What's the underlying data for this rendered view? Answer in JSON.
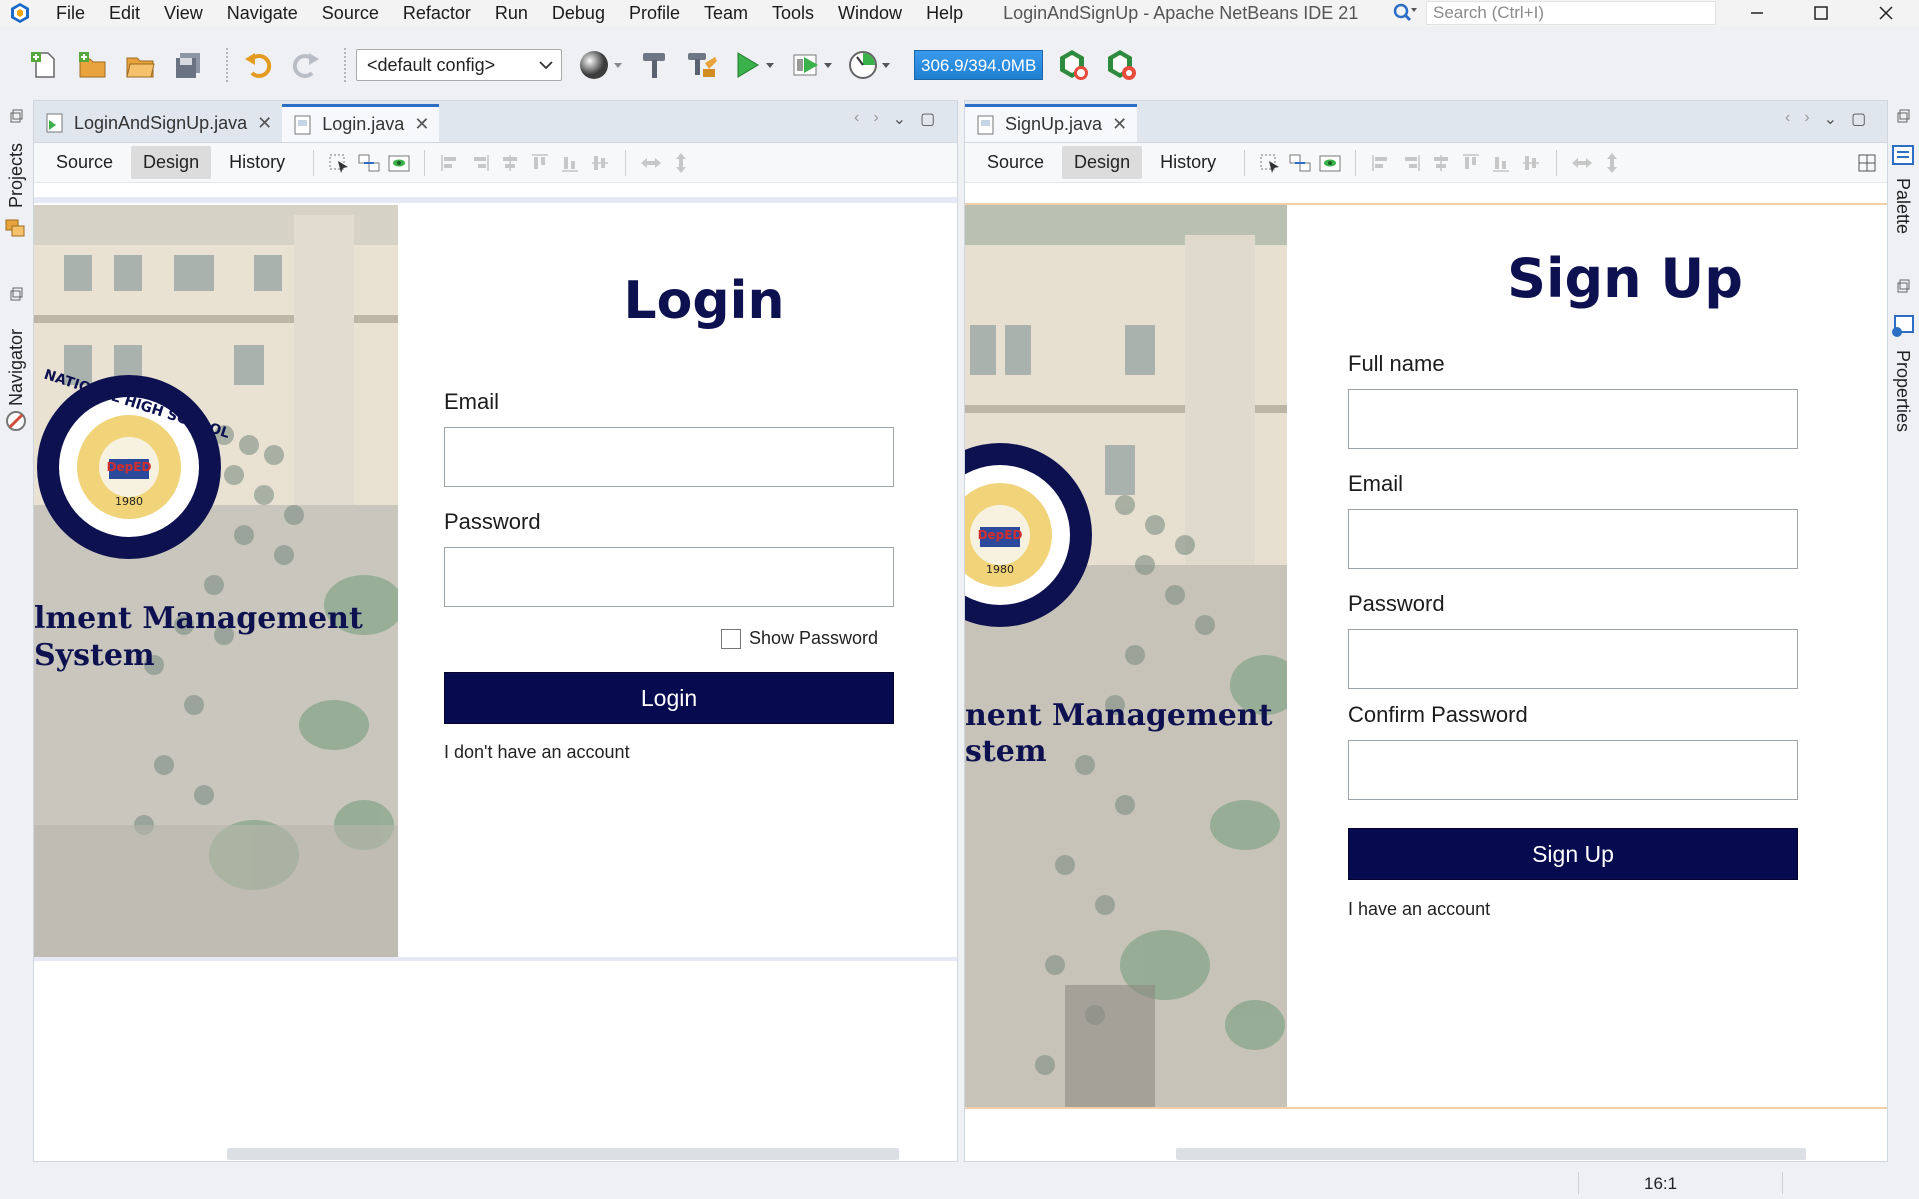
{
  "menubar": {
    "items": [
      "File",
      "Edit",
      "View",
      "Navigate",
      "Source",
      "Refactor",
      "Run",
      "Debug",
      "Profile",
      "Team",
      "Tools",
      "Window",
      "Help"
    ],
    "window_title": "LoginAndSignUp - Apache NetBeans IDE 21",
    "search_placeholder": "Search (Ctrl+I)"
  },
  "toolbar": {
    "config": "<default config>",
    "memory": "306.9/394.0MB"
  },
  "sidebars": {
    "left": [
      "Projects",
      "Navigator"
    ],
    "right": [
      "Palette",
      "Properties"
    ]
  },
  "left_pane": {
    "tabs": [
      {
        "label": "LoginAndSignUp.java",
        "active": false
      },
      {
        "label": "Login.java",
        "active": true
      }
    ],
    "subtabs": [
      "Source",
      "Design",
      "History"
    ],
    "selected_subtab": "Design"
  },
  "right_pane": {
    "tabs": [
      {
        "label": "SignUp.java",
        "active": true
      }
    ],
    "subtabs": [
      "Source",
      "Design",
      "History"
    ],
    "selected_subtab": "Design"
  },
  "login_form": {
    "title": "Login",
    "email_label": "Email",
    "password_label": "Password",
    "show_password": "Show Password",
    "button": "Login",
    "link": "I don't have an account",
    "banner_line1": "lment Management",
    "banner_line2": "System",
    "seal_text": "NATIONAL HIGH SCHOOL",
    "seal_year": "1980"
  },
  "signup_form": {
    "title": "Sign Up",
    "fullname_label": "Full name",
    "email_label": "Email",
    "password_label": "Password",
    "confirm_label": "Confirm Password",
    "button": "Sign Up",
    "link": "I have an account",
    "banner_line1": "nent Management",
    "banner_line2": "stem"
  },
  "status": {
    "position": "16:1"
  },
  "colors": {
    "form_primary": "#060a4e",
    "ide_accent": "#2b6ec4",
    "memory_bar": "#2b8de0"
  }
}
